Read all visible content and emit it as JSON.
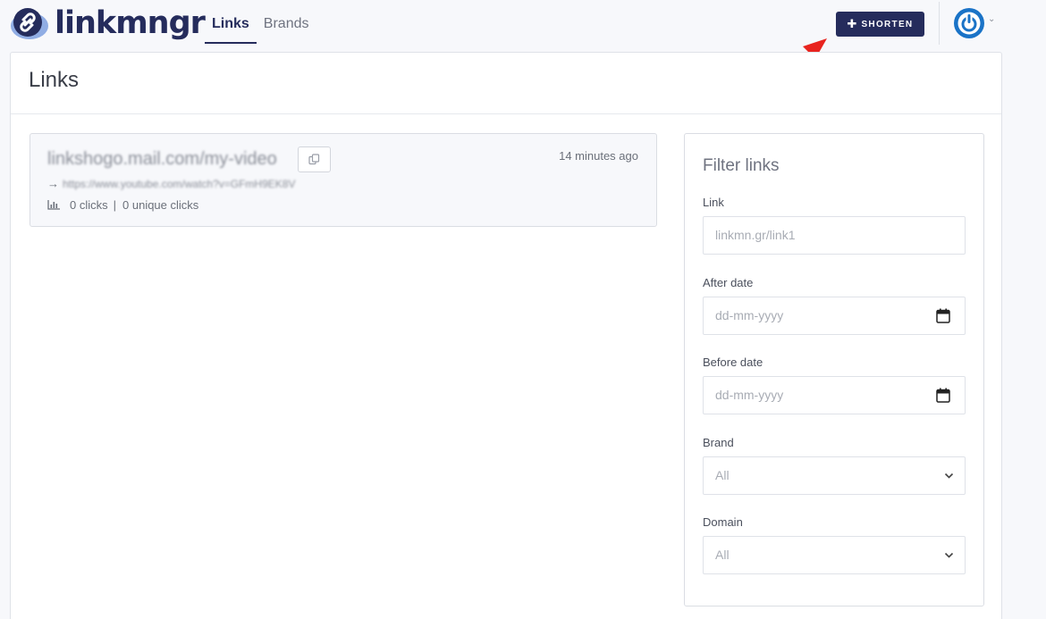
{
  "app": {
    "logo_text": "linkmngr"
  },
  "nav": {
    "items": [
      {
        "label": "Links",
        "active": true
      },
      {
        "label": "Brands",
        "active": false
      }
    ]
  },
  "toolbar": {
    "shorten_label": "SHORTEN",
    "plus_icon": "plus-icon"
  },
  "page": {
    "title": "Links"
  },
  "link_card": {
    "short_url": "linkshogo.mail.com/my-video",
    "destination_url": "https://www.youtube.com/watch?v=GFmH9EK8V",
    "time_ago": "14 minutes ago",
    "clicks": "0 clicks",
    "unique_clicks": "0 unique clicks",
    "separator": "|"
  },
  "filter": {
    "title": "Filter links",
    "link_label": "Link",
    "link_placeholder": "linkmn.gr/link1",
    "after_label": "After date",
    "after_placeholder": "dd-mm-yyyy",
    "before_label": "Before date",
    "before_placeholder": "dd-mm-yyyy",
    "brand_label": "Brand",
    "brand_value": "All",
    "domain_label": "Domain",
    "domain_value": "All"
  },
  "colors": {
    "brand": "#252c5c",
    "accent_blue": "#1a73c7",
    "annotation": "#e8241f"
  }
}
